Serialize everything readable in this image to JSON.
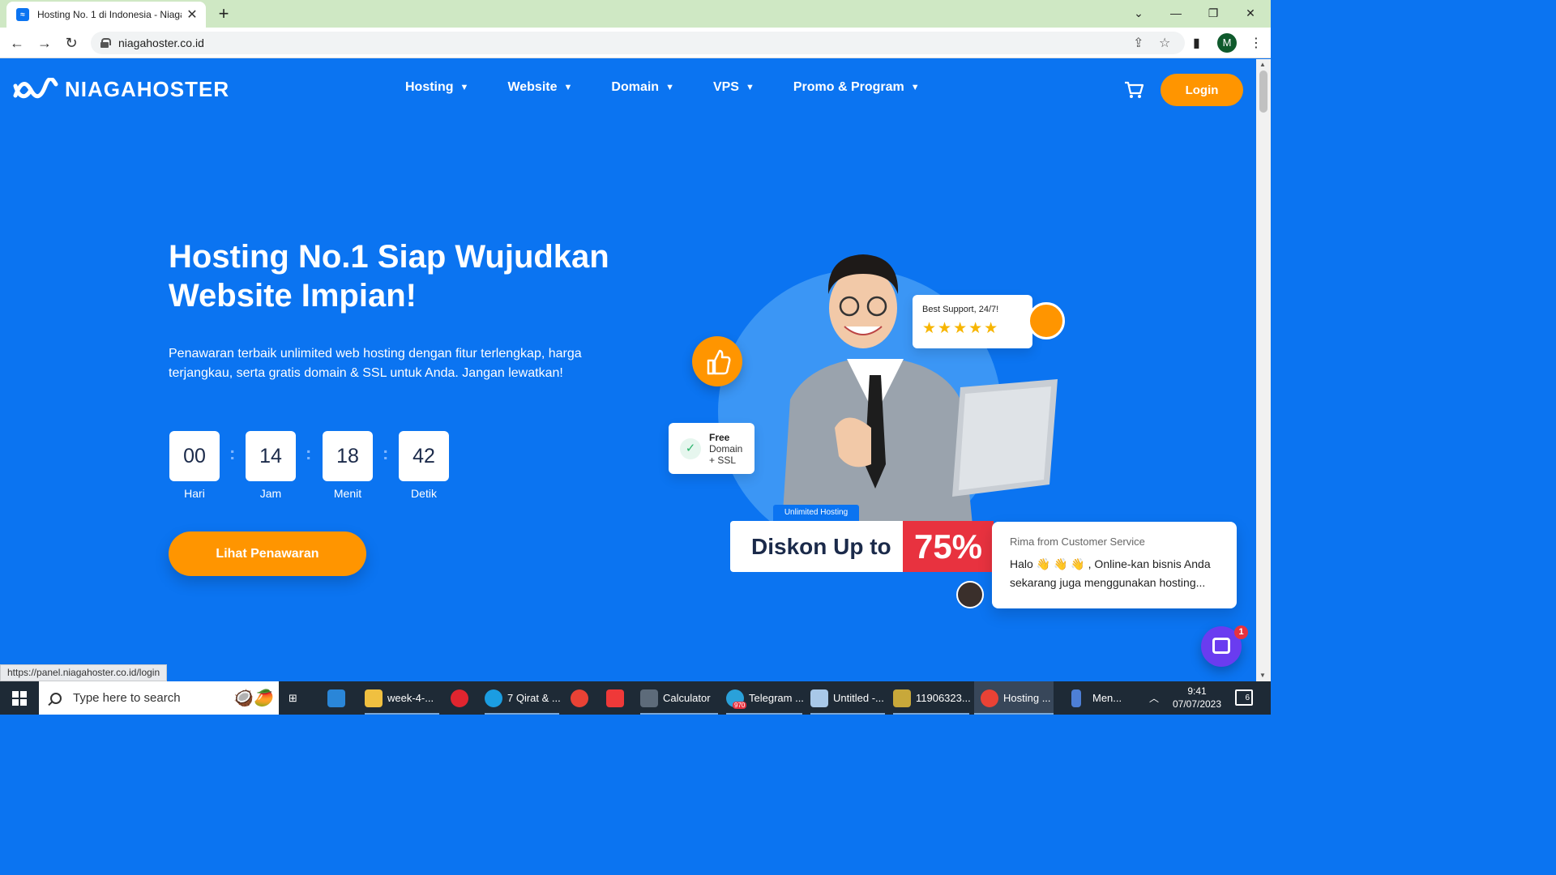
{
  "browser": {
    "tab_title": "Hosting No. 1 di Indonesia - Niagahoster",
    "tab_close": "✕",
    "new_tab": "+",
    "url": "niagahoster.co.id",
    "profile_initial": "M",
    "status_url": "https://panel.niagahoster.co.id/login"
  },
  "header": {
    "logo_text": "NIAGAHOSTER",
    "nav": [
      {
        "label": "Hosting"
      },
      {
        "label": "Website"
      },
      {
        "label": "Domain"
      },
      {
        "label": "VPS"
      },
      {
        "label": "Promo & Program"
      }
    ],
    "login_label": "Login"
  },
  "hero": {
    "title": "Hosting No.1 Siap Wujudkan Website Impian!",
    "subtitle": "Penawaran terbaik unlimited web hosting dengan fitur terlengkap, harga terjangkau, serta gratis domain & SSL untuk Anda. Jangan lewatkan!",
    "countdown": [
      {
        "value": "00",
        "label": "Hari"
      },
      {
        "value": "14",
        "label": "Jam"
      },
      {
        "value": "18",
        "label": "Menit"
      },
      {
        "value": "42",
        "label": "Detik"
      }
    ],
    "cta_label": "Lihat Penawaran"
  },
  "illustration": {
    "support_title": "Best Support, 24/7!",
    "stars": "★★★★★",
    "free_line1": "Free",
    "free_line2": "Domain",
    "free_line3": "+ SSL",
    "unlimited_tag": "Unlimited Hosting",
    "diskon_text": "Diskon Up to",
    "diskon_pct": "75%"
  },
  "chat": {
    "from": "Rima from Customer Service",
    "message": "Halo 👋 👋 👋 , Online-kan bisnis Anda sekarang juga menggunakan hosting...",
    "badge": "1"
  },
  "taskbar": {
    "search_placeholder": "Type here to search",
    "items": [
      {
        "label": "week-4-..."
      },
      {
        "label": "7 Qirat & ..."
      },
      {
        "label": "Calculator"
      },
      {
        "label": "Telegram ..."
      },
      {
        "label": "Untitled -..."
      },
      {
        "label": "11906323..."
      },
      {
        "label": "Hosting ..."
      },
      {
        "label": "Men..."
      }
    ],
    "telegram_badge": "970",
    "time": "9:41",
    "date": "07/07/2023",
    "notif_count": "6"
  },
  "colors": {
    "brand_blue": "#0b74f1",
    "accent_orange": "#ff9500",
    "discount_red": "#e8323f",
    "chat_purple": "#6a3cf0"
  }
}
